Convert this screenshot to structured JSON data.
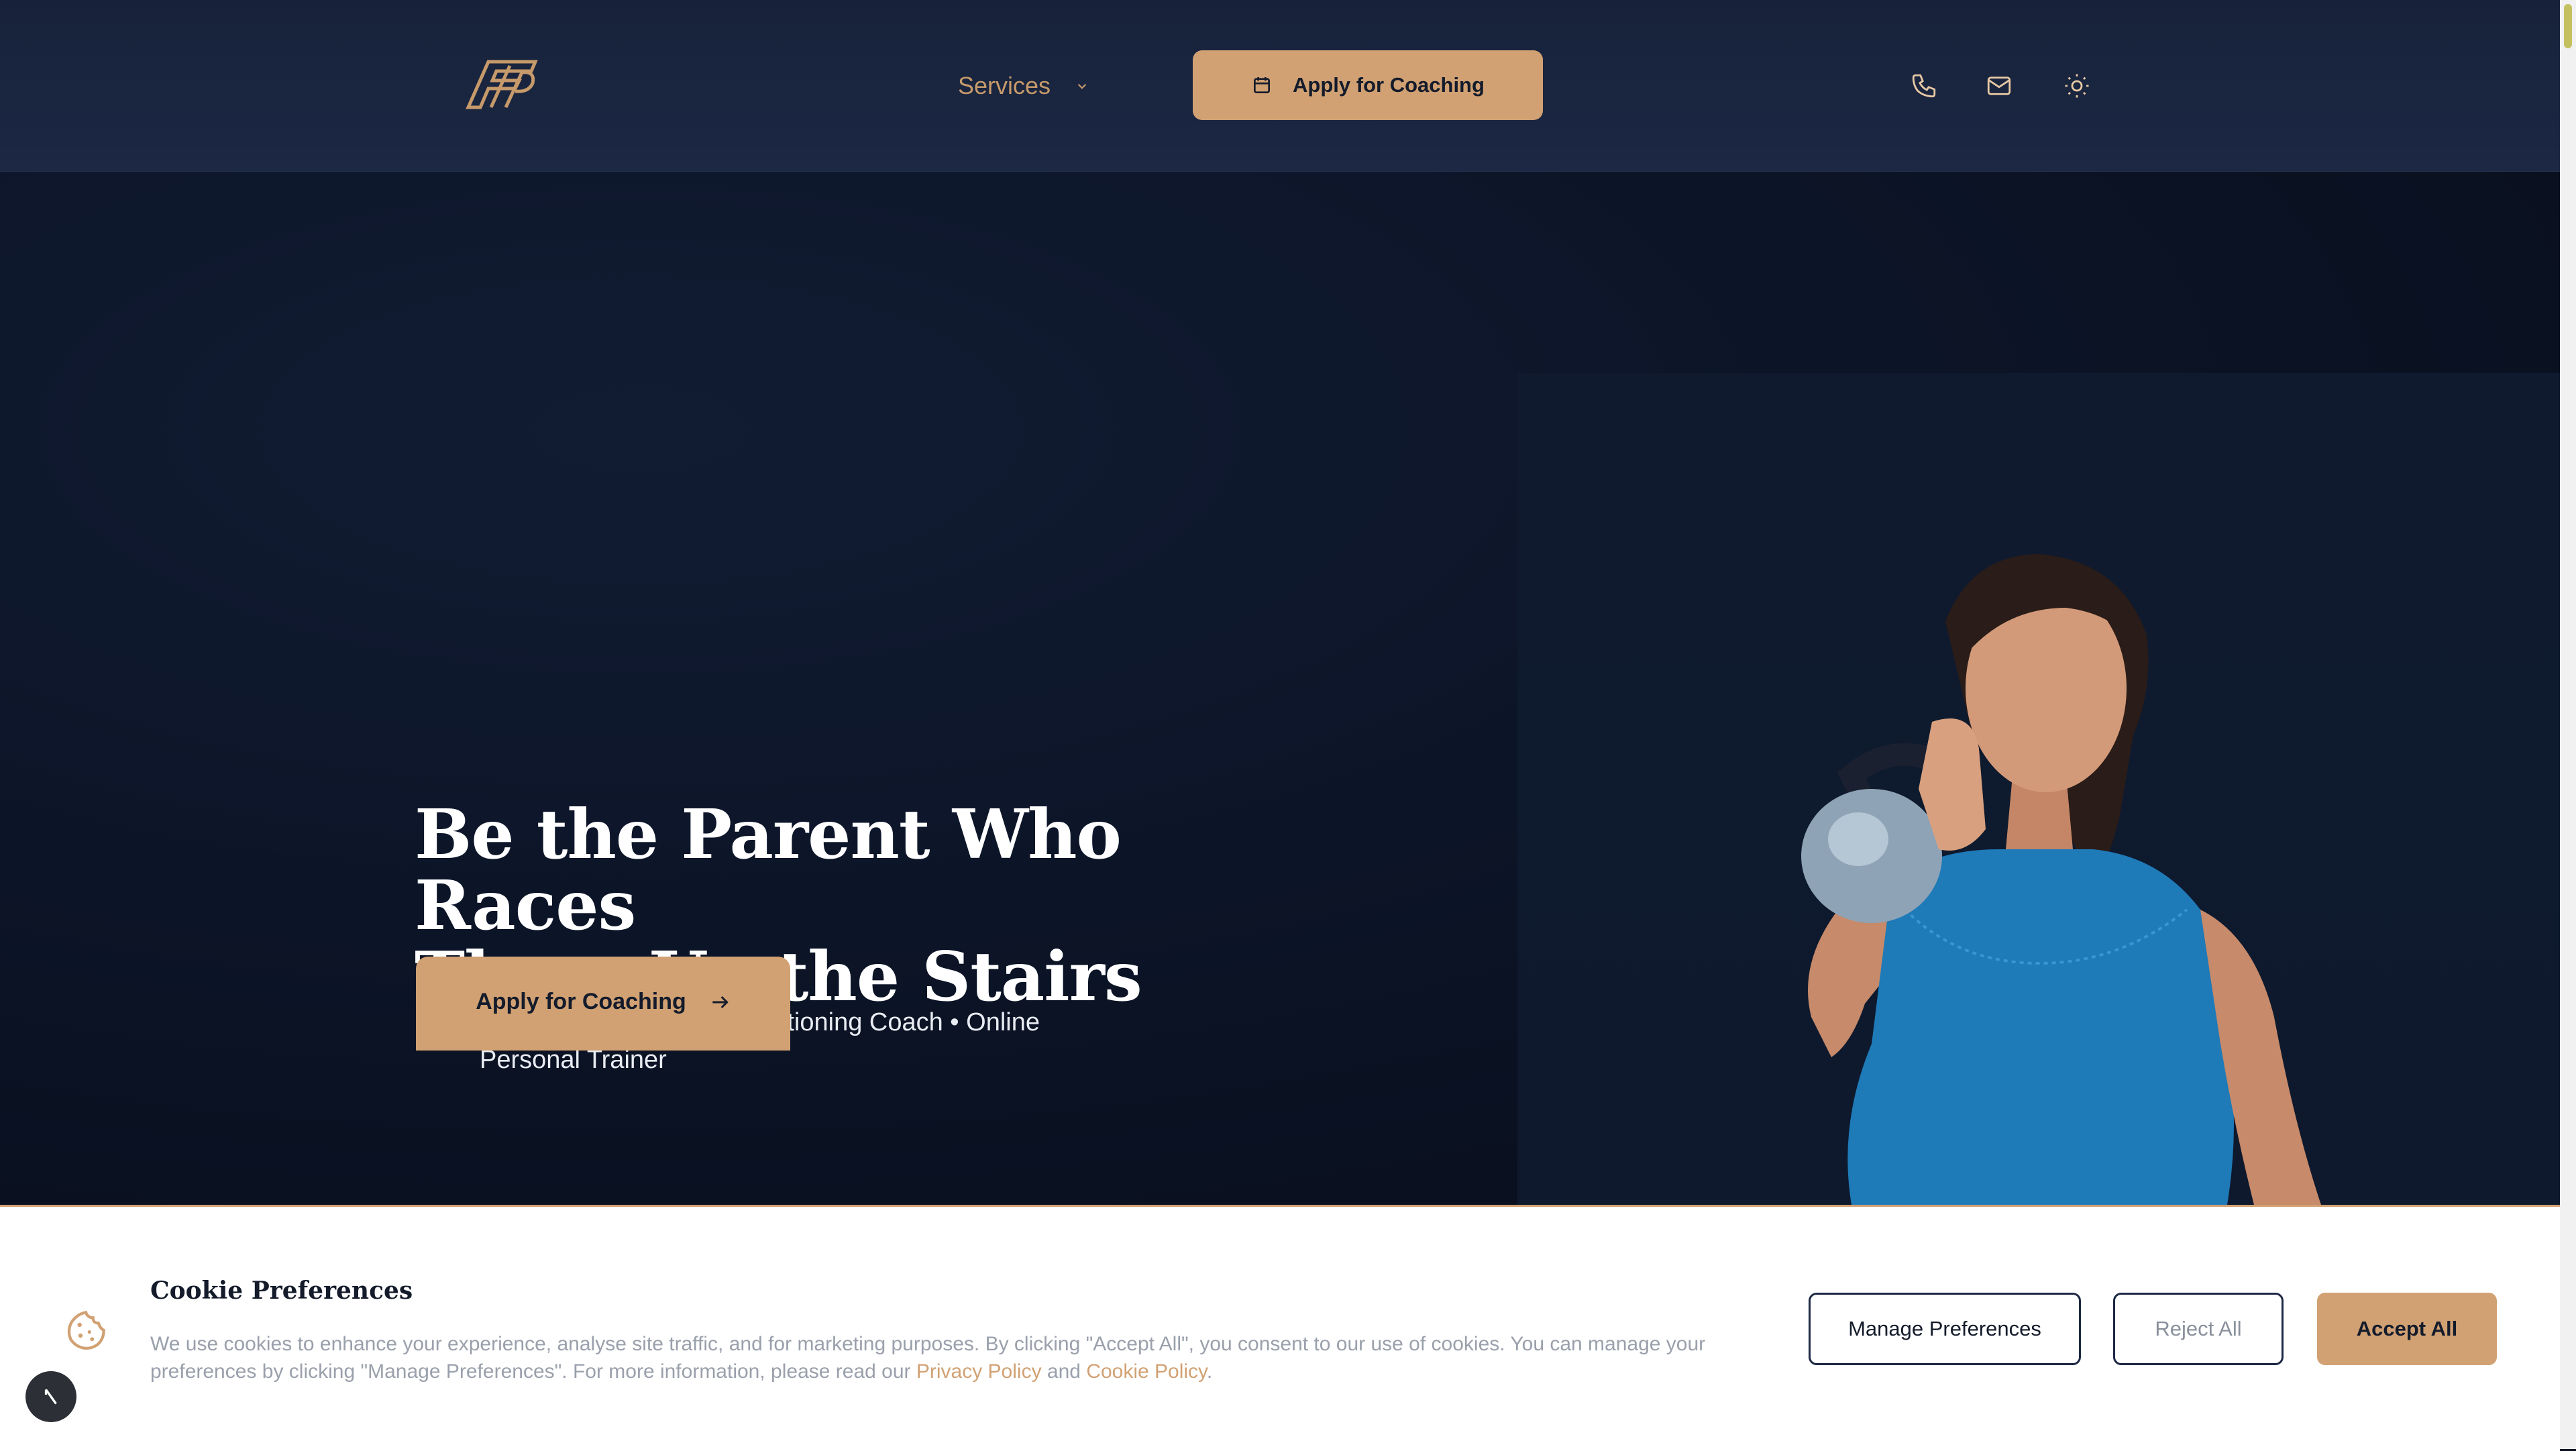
{
  "header": {
    "services_label": "Services",
    "apply_label": "Apply for Coaching"
  },
  "hero": {
    "title_line1": "Be the Parent Who Races",
    "title_line2": "Them Up the Stairs",
    "subtitle": "Norfolk Strength and Conditioning Coach • Online Personal Trainer",
    "cta_label": "Apply for Coaching"
  },
  "cookie": {
    "title": "Cookie Preferences",
    "text_before": "We use cookies to enhance your experience, analyse site traffic, and for marketing purposes. By clicking \"Accept All\", you consent to our use of cookies. You can manage your preferences by clicking \"Manage Preferences\". For more information, please read our ",
    "privacy_link": "Privacy Policy",
    "and": " and ",
    "cookie_link": "Cookie Policy",
    "period": ".",
    "manage_label": "Manage Preferences",
    "reject_label": "Reject All",
    "accept_label": "Accept All"
  },
  "icons": {
    "logo": "ffp-logo",
    "services_chevron": "chevron-down-icon",
    "header_cta": "calendar-icon",
    "phone": "phone-icon",
    "mail": "mail-icon",
    "theme": "sun-icon",
    "hero_cta": "arrow-right-icon",
    "cookie": "cookie-icon",
    "badge": "compass-icon"
  },
  "colors": {
    "navy": "#17223a",
    "gold": "#d1a173",
    "white": "#ffffff"
  }
}
